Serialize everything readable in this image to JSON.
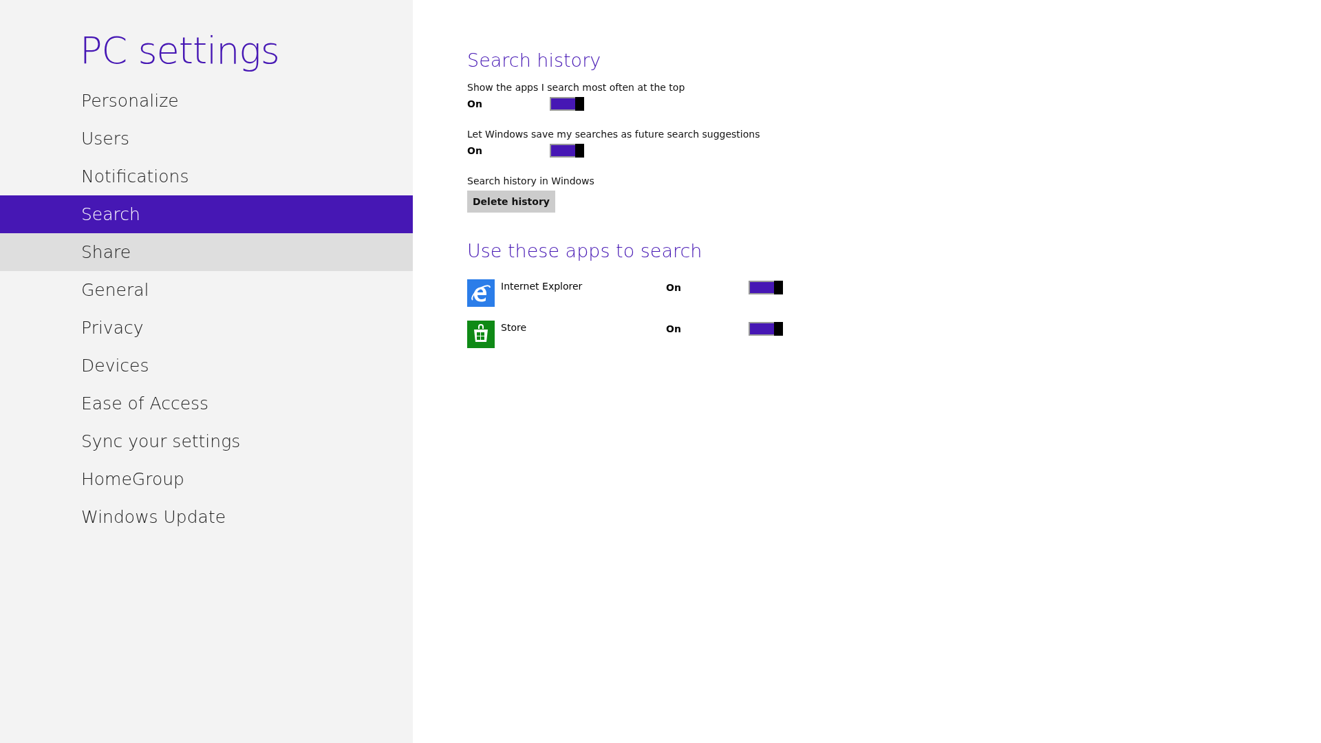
{
  "sidebar": {
    "title": "PC settings",
    "items": [
      {
        "label": "Personalize",
        "selected": false,
        "hovered": false
      },
      {
        "label": "Users",
        "selected": false,
        "hovered": false
      },
      {
        "label": "Notifications",
        "selected": false,
        "hovered": false
      },
      {
        "label": "Search",
        "selected": true,
        "hovered": false
      },
      {
        "label": "Share",
        "selected": false,
        "hovered": true
      },
      {
        "label": "General",
        "selected": false,
        "hovered": false
      },
      {
        "label": "Privacy",
        "selected": false,
        "hovered": false
      },
      {
        "label": "Devices",
        "selected": false,
        "hovered": false
      },
      {
        "label": "Ease of Access",
        "selected": false,
        "hovered": false
      },
      {
        "label": "Sync your settings",
        "selected": false,
        "hovered": false
      },
      {
        "label": "HomeGroup",
        "selected": false,
        "hovered": false
      },
      {
        "label": "Windows Update",
        "selected": false,
        "hovered": false
      }
    ]
  },
  "search_history": {
    "heading": "Search history",
    "settings": [
      {
        "kind": "toggle",
        "label": "Show the apps I search most often at the top",
        "state_text": "On",
        "on": true
      },
      {
        "kind": "toggle",
        "label": "Let Windows save my searches as future search suggestions",
        "state_text": "On",
        "on": true
      },
      {
        "kind": "button",
        "label": "Search history in Windows",
        "button": "Delete history"
      }
    ]
  },
  "apps_section": {
    "heading": "Use these apps to search",
    "apps": [
      {
        "kind": "browser",
        "name": "Internet Explorer",
        "state_text": "On",
        "on": true
      },
      {
        "kind": "store",
        "name": "Store",
        "state_text": "On",
        "on": true
      }
    ]
  }
}
